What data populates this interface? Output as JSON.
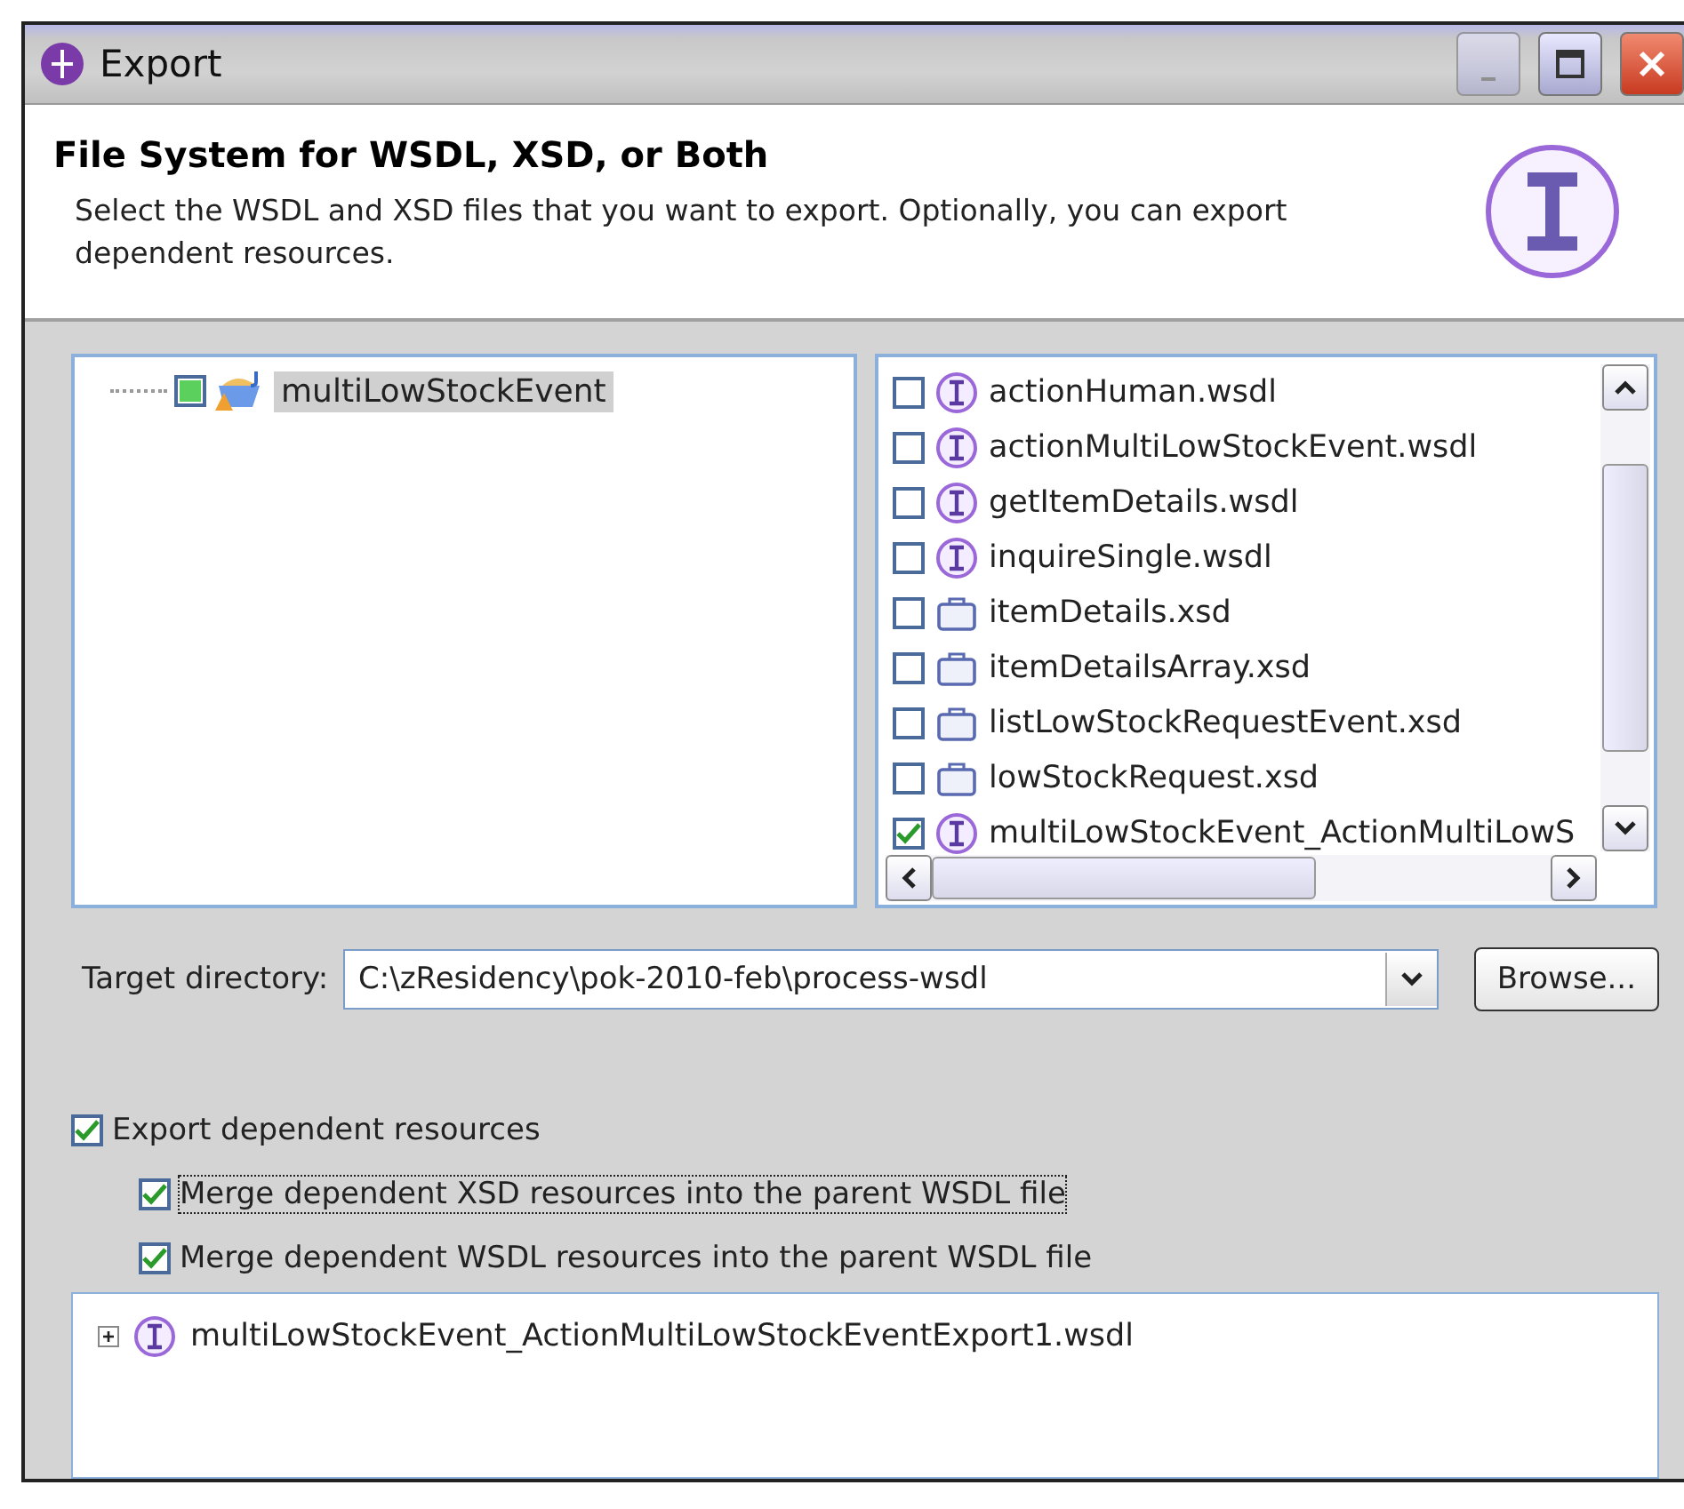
{
  "window": {
    "title": "Export"
  },
  "header": {
    "title": "File System for WSDL, XSD, or Both",
    "description": "Select the WSDL and XSD files that you want to export. Optionally, you can export dependent resources."
  },
  "project_tree": [
    {
      "label": "multiLowStockEvent",
      "checked": true,
      "grayed": true,
      "selected": true
    }
  ],
  "files": [
    {
      "name": "actionHuman.wsdl",
      "kind": "wsdl",
      "checked": false
    },
    {
      "name": "actionMultiLowStockEvent.wsdl",
      "kind": "wsdl",
      "checked": false
    },
    {
      "name": "getItemDetails.wsdl",
      "kind": "wsdl",
      "checked": false
    },
    {
      "name": "inquireSingle.wsdl",
      "kind": "wsdl",
      "checked": false
    },
    {
      "name": "itemDetails.xsd",
      "kind": "xsd",
      "checked": false
    },
    {
      "name": "itemDetailsArray.xsd",
      "kind": "xsd",
      "checked": false
    },
    {
      "name": "listLowStockRequestEvent.xsd",
      "kind": "xsd",
      "checked": false
    },
    {
      "name": "lowStockRequest.xsd",
      "kind": "xsd",
      "checked": false
    },
    {
      "name": "multiLowStockEvent_ActionMultiLowS",
      "kind": "wsdl",
      "checked": true
    }
  ],
  "target_directory": {
    "label": "Target directory:",
    "value": "C:\\zResidency\\pok-2010-feb\\process-wsdl",
    "browse_button": "Browse..."
  },
  "options": [
    {
      "label": "Export dependent resources",
      "checked": true,
      "focused": false,
      "children": [
        {
          "label": "Merge dependent XSD resources into the parent WSDL file",
          "checked": true,
          "focused": true
        },
        {
          "label": "Merge dependent WSDL resources into the parent WSDL file",
          "checked": true,
          "focused": false
        }
      ]
    }
  ],
  "result_tree": [
    {
      "label": "multiLowStockEvent_ActionMultiLowStockEventExport1.wsdl",
      "kind": "wsdl",
      "expanded": false
    }
  ]
}
